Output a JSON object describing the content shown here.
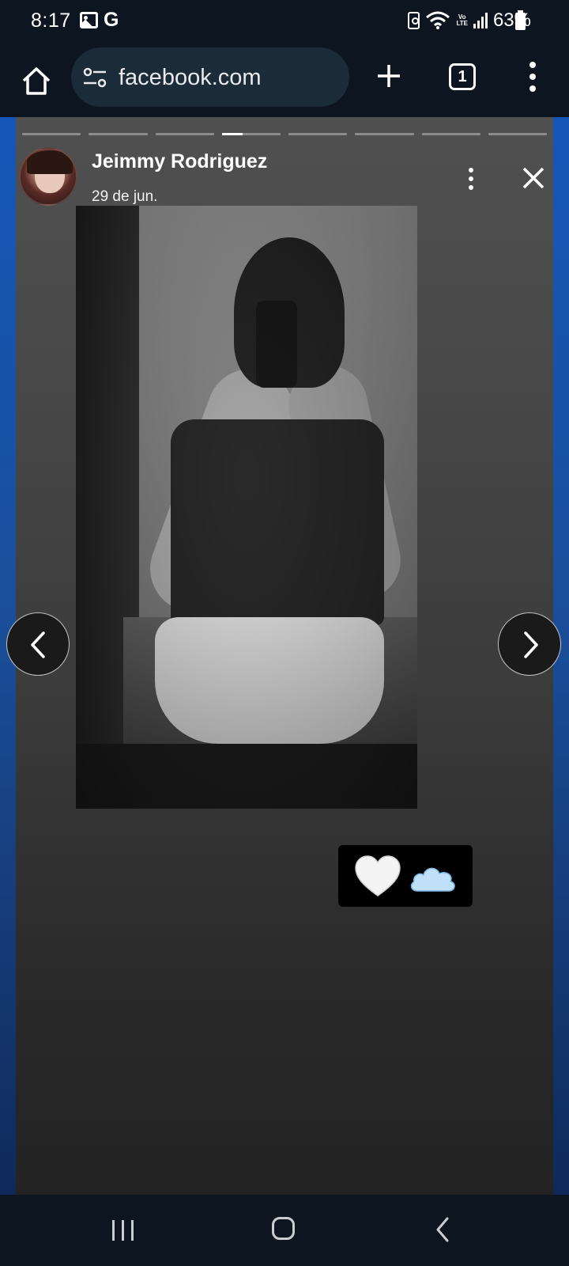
{
  "status_bar": {
    "time": "8:17",
    "carrier_icon_letter": "G",
    "lte_label_top": "Vo",
    "lte_label_bottom": "LTE",
    "battery_percent": "63%",
    "icons": [
      "gallery-icon",
      "google-icon",
      "recycle-icon",
      "wifi-icon",
      "lte-icon",
      "signal-icon",
      "battery-icon"
    ]
  },
  "browser": {
    "url": "facebook.com",
    "tab_count": "1",
    "icons": [
      "home-icon",
      "site-settings-icon",
      "plus-icon",
      "tabs-icon",
      "more-vertical-icon"
    ]
  },
  "story": {
    "author_name": "Jeimmy Rodriguez",
    "date": "29 de jun.",
    "segments_total": 8,
    "active_segment": 4,
    "active_segment_progress": 0.35,
    "sticker_emoji": [
      "white-heart",
      "cloud"
    ],
    "icons": [
      "more-vertical-icon",
      "close-icon",
      "chevron-left-icon",
      "chevron-right-icon"
    ]
  },
  "android_nav": {
    "icons": [
      "recents-icon",
      "home-icon",
      "back-icon"
    ]
  },
  "colors": {
    "chrome_bg": "#0d1520",
    "url_bar_bg": "#1c2b38",
    "viewer_side_blue": "#1557b8",
    "story_bg_top": "#505050",
    "story_bg_bottom": "#232323"
  }
}
